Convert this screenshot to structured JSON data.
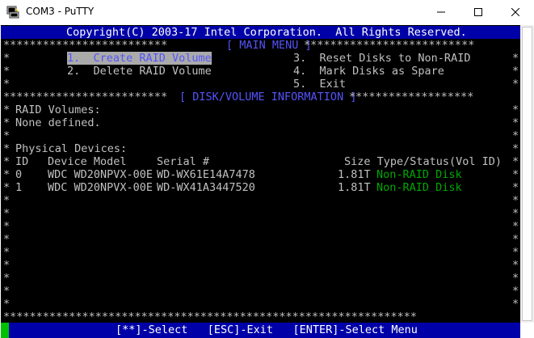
{
  "window": {
    "title": "COM3 - PuTTY",
    "app_icon": "putty-icon",
    "controls": {
      "minimize": "minimize-icon",
      "maximize": "maximize-icon",
      "close": "close-icon"
    }
  },
  "terminal": {
    "copyright": "Copyright(C) 2003-17 Intel Corporation.  All Rights Reserved.",
    "main_menu_header": "[ MAIN MENU ]",
    "menu_left": [
      {
        "label": "1.  Create RAID Volume",
        "selected": true
      },
      {
        "label": "2.  Delete RAID Volume",
        "selected": false
      }
    ],
    "menu_right": [
      {
        "label": "3.  Reset Disks to Non-RAID"
      },
      {
        "label": "4.  Mark Disks as Spare"
      },
      {
        "label": "5.  Exit"
      }
    ],
    "info_header": "[ DISK/VOLUME INFORMATION ]",
    "raid_volumes_label": "RAID Volumes:",
    "raid_volumes_value": "None defined.",
    "physical_devices_label": "Physical Devices:",
    "columns": {
      "id": "ID",
      "model": "Device Model",
      "serial": "Serial #",
      "size_status": "Size Type/Status(Vol ID)"
    },
    "devices": [
      {
        "id": "0",
        "model": "WDC WD20NPVX-00E",
        "serial": "WD-WX61E14A7478",
        "size": "1.81T",
        "status": "Non-RAID Disk"
      },
      {
        "id": "1",
        "model": "WDC WD20NPVX-00E",
        "serial": "WD-WX41A3447520",
        "size": "1.81T",
        "status": "Non-RAID Disk"
      }
    ],
    "help_bar": "[**]-Select   [ESC]-Exit   [ENTER]-Select Menu"
  },
  "colors": {
    "banner_bg": "#0000a8",
    "heading": "#5454fc",
    "highlight_bg": "#aaaaaa",
    "status_green": "#00a800",
    "terminal_text": "#c0c0c0",
    "cursor": "#00c000"
  }
}
